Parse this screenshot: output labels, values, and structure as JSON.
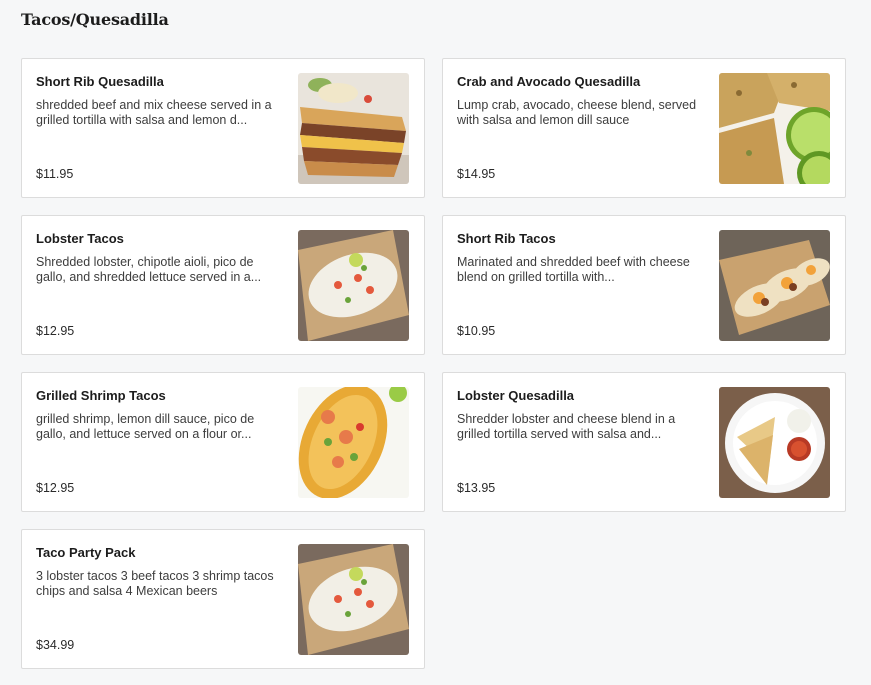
{
  "section": {
    "title": "Tacos/Quesadilla"
  },
  "items": [
    {
      "name": "Short Rib Quesadilla",
      "description": "shredded beef and mix cheese served in a grilled tortilla with salsa and lemon d...",
      "price": "$11.95",
      "image": "short-rib-quesadilla-photo"
    },
    {
      "name": "Crab and Avocado Quesadilla",
      "description": "Lump crab, avocado, cheese blend, served with salsa and lemon dill sauce",
      "price": "$14.95",
      "image": "crab-avocado-quesadilla-photo"
    },
    {
      "name": "Lobster Tacos",
      "description": "Shredded lobster, chipotle aioli, pico de gallo, and shredded lettuce served in a...",
      "price": "$12.95",
      "image": "lobster-tacos-photo"
    },
    {
      "name": "Short Rib Tacos",
      "description": "Marinated and shredded beef with cheese blend on grilled tortilla with...",
      "price": "$10.95",
      "image": "short-rib-tacos-photo"
    },
    {
      "name": "Grilled Shrimp Tacos",
      "description": "grilled shrimp, lemon dill sauce, pico de gallo, and lettuce served on a flour or...",
      "price": "$12.95",
      "image": "grilled-shrimp-tacos-photo"
    },
    {
      "name": "Lobster Quesadilla",
      "description": "Shredder lobster and cheese blend in a grilled tortilla served with salsa and...",
      "price": "$13.95",
      "image": "lobster-quesadilla-photo"
    },
    {
      "name": "Taco Party Pack",
      "description": "3 lobster tacos 3 beef tacos 3 shrimp tacos chips and salsa 4 Mexican beers",
      "price": "$34.99",
      "image": "taco-party-pack-photo"
    }
  ]
}
